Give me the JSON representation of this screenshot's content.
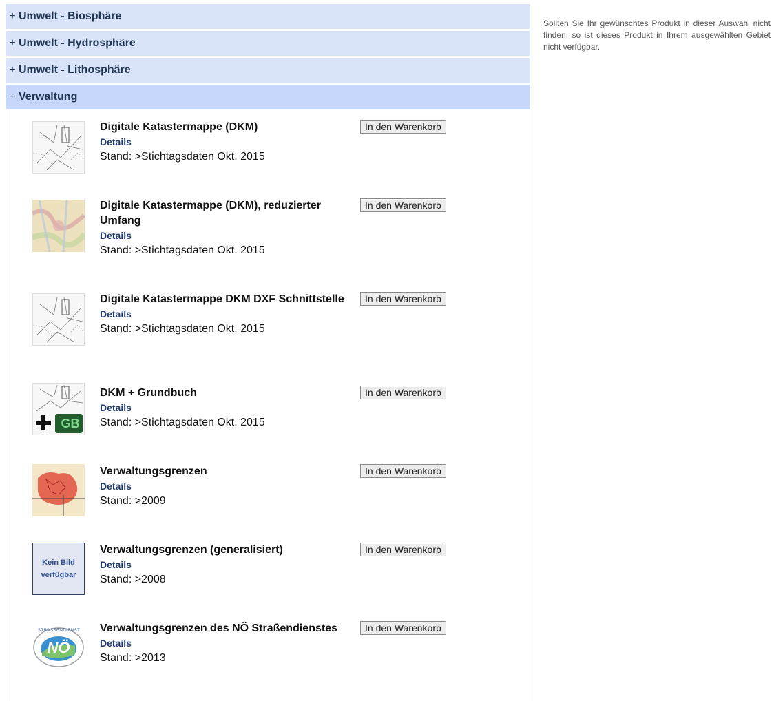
{
  "categories": [
    {
      "sign": "+",
      "label": "Umwelt - Biosphäre"
    },
    {
      "sign": "+",
      "label": "Umwelt - Hydrosphäre"
    },
    {
      "sign": "+",
      "label": "Umwelt - Lithosphäre"
    },
    {
      "sign": "−",
      "label": "Verwaltung"
    }
  ],
  "products": [
    {
      "name": "Digitale Katastermappe (DKM)",
      "details": "Details",
      "stand": "Stand: >Stichtagsdaten Okt. 2015",
      "cart": "In den Warenkorb",
      "thumb_icon": "cadastral-map-thumbnail"
    },
    {
      "name": "Digitale Katastermappe (DKM), reduzierter Umfang",
      "details": "Details",
      "stand": "Stand: >Stichtagsdaten Okt. 2015",
      "cart": "In den Warenkorb",
      "thumb_icon": "colored-map-thumbnail"
    },
    {
      "name": "Digitale Katastermappe DKM DXF Schnittstelle",
      "details": "Details",
      "stand": "Stand: >Stichtagsdaten Okt. 2015",
      "cart": "In den Warenkorb",
      "thumb_icon": "cadastral-map-thumbnail"
    },
    {
      "name": "DKM + Grundbuch",
      "details": "Details",
      "stand": "Stand: >Stichtagsdaten Okt. 2015",
      "cart": "In den Warenkorb",
      "thumb_icon": "cadastral-gb-thumbnail",
      "thumb_text": "GB"
    },
    {
      "name": "Verwaltungsgrenzen",
      "details": "Details",
      "stand": "Stand: >2009",
      "cart": "In den Warenkorb",
      "thumb_icon": "boundaries-map-thumbnail"
    },
    {
      "name": "Verwaltungsgrenzen (generalisiert)",
      "details": "Details",
      "stand": "Stand: >2008",
      "cart": "In den Warenkorb",
      "thumb_icon": "no-image-thumbnail",
      "thumb_text": "Kein Bild verfügbar"
    },
    {
      "name": "Verwaltungsgrenzen des NÖ Straßendienstes",
      "details": "Details",
      "stand": "Stand: >2013",
      "cart": "In den Warenkorb",
      "thumb_icon": "noe-strassendienst-logo",
      "thumb_text": "NÖ",
      "thumb_ring_text": "STRASSENDIENST"
    }
  ],
  "side_note": "Sollten Sie Ihr gewünschtes Produkt in dieser Auswahl nicht finden, so ist dieses Produkt in Ihrem ausgewählten Gebiet nicht verfügbar.",
  "colors": {
    "header_bg": "#d9e4fb",
    "header_open_bg": "#c6d7fb",
    "header_text": "#1f3550",
    "details_link": "#1f3a6e"
  }
}
